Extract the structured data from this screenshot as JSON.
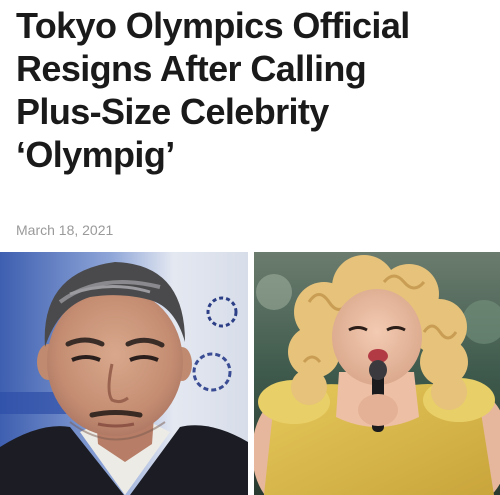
{
  "article": {
    "headline_lines": [
      "Tokyo Olympics Official",
      "Resigns After Calling",
      "Plus-Size Celebrity",
      "‘Olympig’"
    ],
    "date": "March 18, 2021"
  },
  "photos": [
    {
      "subject": "older man in dark suit at press conference"
    },
    {
      "subject": "performer with curly blonde hair in yellow dress singing into microphone"
    }
  ],
  "colors": {
    "headline": "#1a1a1a",
    "date": "#9a9a9a",
    "background": "#ffffff"
  }
}
